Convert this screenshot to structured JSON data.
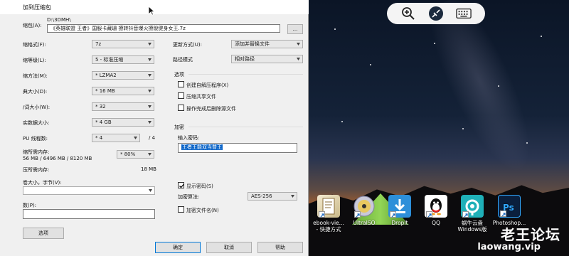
{
  "dialog": {
    "title": "加到压缩包",
    "archive_label": "缩包(A):",
    "archive_dir": "D:\\3DMH\\",
    "archive_path": "《英雄联盟 王者》国服卡藏珊 撩转抖音爆火撩骰健身女王.7z",
    "browse_label": "...",
    "format_label": "缩格式(F):",
    "format_value": "7z",
    "level_label": "缩等级(L):",
    "level_value": "5 - 标准压缩",
    "method_label": "缩方法(M):",
    "method_value": "* LZMA2",
    "dict_label": "典大小(D):",
    "dict_value": "* 16 MB",
    "word_label": "/词大小(W):",
    "word_value": "* 32",
    "solid_label": "实数据大小:",
    "solid_value": "* 4 GB",
    "cpu_label": "PU 线程数:",
    "cpu_value": "* 4",
    "cpu_total": "/ 4",
    "mem_label": "缩所需内存:",
    "mem_value": "56 MB / 6496 MB / 8120 MB",
    "mem_percent": "* 80%",
    "decomp_label": "压所需内存:",
    "decomp_value": "18 MB",
    "volume_label": "卷大小，字节(V):",
    "params_label": "数(P):",
    "options_button": "选项",
    "update_label": "更新方式(U):",
    "update_value": "添加并替换文件",
    "pathmode_label": "路径模式",
    "pathmode_value": "相对路径",
    "options_group": "选项",
    "opt_sfx": "创建自解压程序(X)",
    "opt_shared": "压缩共享文件",
    "opt_delete": "操作完成后删除源文件",
    "encrypt_group": "加密",
    "password_label": "输入密码:",
    "password_value": "王者王能双当普王",
    "show_password": "显示密码(S)",
    "enc_method_label": "加密算法:",
    "enc_method_value": "AES-256",
    "encrypt_names": "加密文件名(N)",
    "ok_button": "确定",
    "cancel_button": "取消",
    "help_button": "帮助"
  },
  "desktop_icons": [
    {
      "label1": "ebook-vie...",
      "label2": "- 快捷方式",
      "color": "#e8e0c8"
    },
    {
      "label1": "UltraISO",
      "label2": "",
      "color": "#d9d9e8"
    },
    {
      "label1": "DropIt",
      "label2": "",
      "color": "#2d8fd9"
    },
    {
      "label1": "QQ",
      "label2": "",
      "color": "#ffffff"
    },
    {
      "label1": "蜗牛云盘",
      "label2": "Windows版",
      "color": "#1fb0b8"
    },
    {
      "label1": "Photoshop...",
      "label2": "",
      "color": "#0a1f3d"
    }
  ],
  "watermark": {
    "title": "老王论坛",
    "url": "laowang.vip"
  }
}
